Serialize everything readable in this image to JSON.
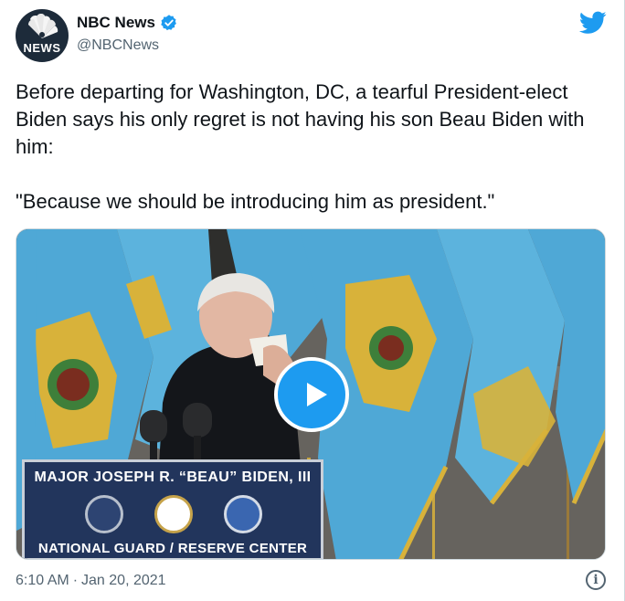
{
  "account": {
    "display_name": "NBC News",
    "handle": "@NBCNews",
    "avatar_text": "NEWS",
    "verified": true
  },
  "icons": {
    "brand": "twitter-bird-icon",
    "verified": "verified-badge-icon",
    "play": "play-icon",
    "info": "info-icon"
  },
  "tweet": {
    "paragraph_1": "Before departing for Washington, DC, a tearful President-elect Biden says his only regret is not having his son Beau Biden with him:",
    "paragraph_2": "\"Because we should be introducing him as president.\""
  },
  "media": {
    "type": "video",
    "sign_top": "MAJOR JOSEPH R. “BEAU” BIDEN, III",
    "sign_bottom": "NATIONAL GUARD / RESERVE CENTER"
  },
  "footer": {
    "time": "6:10 AM",
    "separator": "·",
    "date": "Jan 20, 2021",
    "info_glyph": "i"
  },
  "colors": {
    "accent": "#1d9bf0",
    "text": "#0f1419",
    "secondary_text": "#536471",
    "flag_blue": "#4fa8d6",
    "flag_gold": "#d8b23a",
    "sign_navy": "#22355c"
  }
}
